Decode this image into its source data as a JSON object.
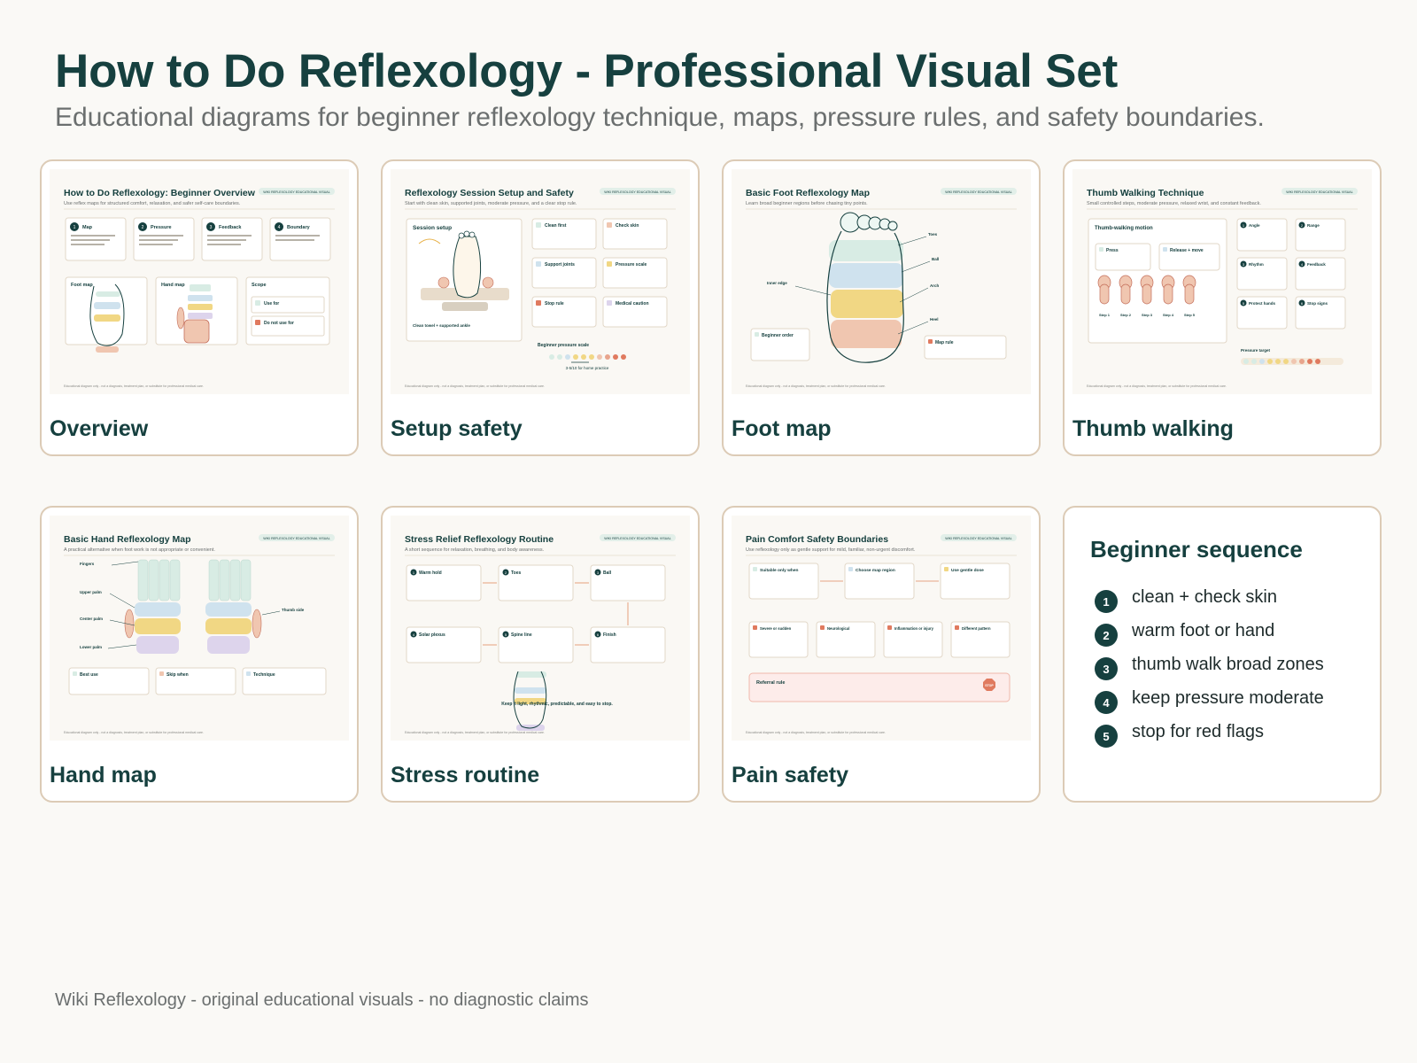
{
  "page": {
    "title": "How to Do Reflexology - Professional Visual Set",
    "subtitle": "Educational diagrams for beginner reflexology technique, maps, pressure rules, and safety boundaries.",
    "footer": "Wiki Reflexology - original educational visuals - no diagnostic claims"
  },
  "shared": {
    "badge": "WIKI REFLEXOLOGY EDUCATIONAL VISUAL",
    "disclaimer": "Educational diagram only - not a diagnosis, treatment plan, or substitute for professional medical care."
  },
  "cards": [
    {
      "label": "Overview",
      "thumb_title": "How to Do Reflexology: Beginner Overview",
      "thumb_subtitle": "Use reflex maps for structured comfort, relaxation, and safer self-care boundaries.",
      "steps": [
        "Map",
        "Pressure",
        "Feedback",
        "Boundary"
      ],
      "panels": [
        "Foot map",
        "Hand map",
        "Scope"
      ],
      "scope_items": [
        "Use for",
        "Do not use for"
      ]
    },
    {
      "label": "Setup safety",
      "thumb_title": "Reflexology Session Setup and Safety",
      "thumb_subtitle": "Start with clean skin, supported joints, moderate pressure, and a clear stop rule.",
      "panel": "Session setup",
      "panel_caption": "Clean towel + supported ankle",
      "boxes": [
        "Clean first",
        "Check skin",
        "Support joints",
        "Pressure scale",
        "Stop rule",
        "Medical caution"
      ],
      "scale_title": "Beginner pressure scale",
      "scale_caption": "3-5/10 for home practice"
    },
    {
      "label": "Foot map",
      "thumb_title": "Basic Foot Reflexology Map",
      "thumb_subtitle": "Learn broad beginner regions before chasing tiny points.",
      "zones": [
        "Toes",
        "Ball",
        "Arch",
        "Heel"
      ],
      "side_label": "Inner edge",
      "boxes": [
        "Beginner order",
        "Map rule"
      ]
    },
    {
      "label": "Thumb walking",
      "thumb_title": "Thumb Walking Technique",
      "thumb_subtitle": "Small controlled steps, moderate pressure, relaxed wrist, and constant feedback.",
      "panel": "Thumb-walking motion",
      "motions": [
        "Press",
        "Release + move"
      ],
      "steps": [
        "Step 1",
        "Step 2",
        "Step 3",
        "Step 4",
        "Step 5"
      ],
      "tips": [
        "Angle",
        "Range",
        "Rhythm",
        "Feedback",
        "Protect hands",
        "Stop signs"
      ],
      "target": "Pressure target"
    },
    {
      "label": "Hand map",
      "thumb_title": "Basic Hand Reflexology Map",
      "thumb_subtitle": "A practical alternative when foot work is not appropriate or convenient.",
      "zones": [
        "Fingers",
        "Upper palm",
        "Center palm",
        "Lower palm"
      ],
      "side_label": "Thumb side",
      "boxes": [
        "Best use",
        "Skip when",
        "Technique"
      ]
    },
    {
      "label": "Stress routine",
      "thumb_title": "Stress Relief Reflexology Routine",
      "thumb_subtitle": "A short sequence for relaxation, breathing, and body awareness.",
      "steps": [
        "Warm hold",
        "Toes",
        "Ball",
        "Solar plexus",
        "Spine line",
        "Finish"
      ],
      "caption": "Keep it light, rhythmic, predictable, and easy to stop."
    },
    {
      "label": "Pain safety",
      "thumb_title": "Pain Comfort Safety Boundaries",
      "thumb_subtitle": "Use reflexology only as gentle support for mild, familiar, non-urgent discomfort.",
      "flow": [
        "Suitable only when",
        "Choose map region",
        "Use gentle dose"
      ],
      "flags": [
        "Severe or sudden",
        "Neurological",
        "Inflammation or injury",
        "Different pattern"
      ],
      "rule": "Referral rule",
      "stop": "STOP"
    }
  ],
  "sequence": {
    "title": "Beginner sequence",
    "items": [
      "clean + check skin",
      "warm foot or hand",
      "thumb walk broad zones",
      "keep pressure moderate",
      "stop for red flags"
    ]
  },
  "colors": {
    "ink": "#16403f",
    "card_border": "#dccbb6",
    "zone_mint": "#d8ece4",
    "zone_blue": "#cfe2ee",
    "zone_yellow": "#f1d784",
    "zone_peach": "#f0c6b0",
    "zone_lavender": "#ddd4ec",
    "alert": "#e07a5f"
  }
}
